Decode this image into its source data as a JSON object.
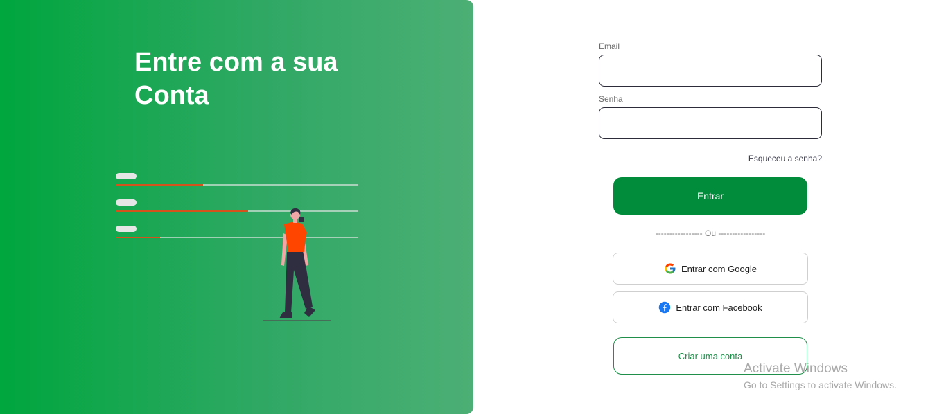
{
  "hero": {
    "title_line1": "Entre com a sua",
    "title_line2": "Conta"
  },
  "form": {
    "email_label": "Email",
    "email_value": "",
    "password_label": "Senha",
    "password_value": "",
    "forgot_link": "Esqueceu a senha?",
    "submit_label": "Entrar",
    "divider_text": "----------------- Ou -----------------",
    "google_label": "Entrar com Google",
    "facebook_label": "Entrar com Facebook",
    "create_account_label": "Criar uma conta"
  },
  "icons": {
    "google": "google-icon",
    "facebook": "facebook-icon"
  },
  "colors": {
    "brand_green": "#008c3a",
    "hero_gradient_start": "#00a63e",
    "hero_gradient_end": "#4caf75",
    "accent_orange": "#ff4500"
  },
  "watermark": {
    "title": "Activate Windows",
    "subtitle": "Go to Settings to activate Windows."
  }
}
